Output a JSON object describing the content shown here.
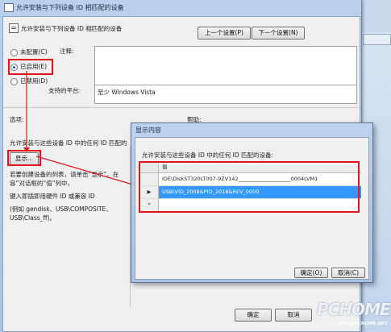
{
  "main_window": {
    "title": "允许安装与下列设备 ID 相匹配的设备",
    "header_text": "允许安装与下列设备 ID 相匹配的设备",
    "prev_button": "上一个设置(P)",
    "next_button": "下一个设置(N)",
    "radio_options": [
      {
        "label": "未配置(C)",
        "checked": false
      },
      {
        "label": "已启用(E)",
        "checked": true
      },
      {
        "label": "已禁用(D)",
        "checked": false
      }
    ],
    "comment_label": "注释:",
    "supported_label": "支持的平台:",
    "supported_value": "至少 Windows Vista",
    "options_label": "选项:",
    "help_label": "帮助:",
    "options_desc": "允许安装与这些设备 ID 中的任何 ID 匹配的",
    "show_button": "显示...",
    "instructions_1": "若要创建设备的列表，请单击“显示”。在",
    "instructions_1b": "容”对话框的“值”列中，",
    "instructions_2": "键入即插即用硬件 ID 或兼容 ID",
    "instructions_3": "(例如 gendisk、USB\\COMPOSITE、",
    "instructions_3b": "USB\\Class_ff)。",
    "ok_button": "确定",
    "cancel_button": "取消"
  },
  "dialog": {
    "title": "显示内容",
    "description": "允许安装与这些设备 ID 中的任何 ID 匹配的设备:",
    "column_header": "值",
    "rows": [
      {
        "marker": "",
        "value": "IDE\\DiskST320LT007-9ZV142____________________0004LVM1"
      },
      {
        "marker": "▶",
        "value": "USB\\VID_2008&PID_2018&REV_0000",
        "selected": true
      },
      {
        "marker": "*",
        "value": ""
      }
    ],
    "ok_button": "确定(O)",
    "cancel_button": "取消(C)"
  },
  "watermark": {
    "brand": "PCHOME",
    "url": "WWW.PCHOME.NET"
  },
  "colors": {
    "highlight_red": "#e0141a",
    "selection_blue": "#3399ff",
    "titlebar_blue": "#b9d1ec"
  }
}
